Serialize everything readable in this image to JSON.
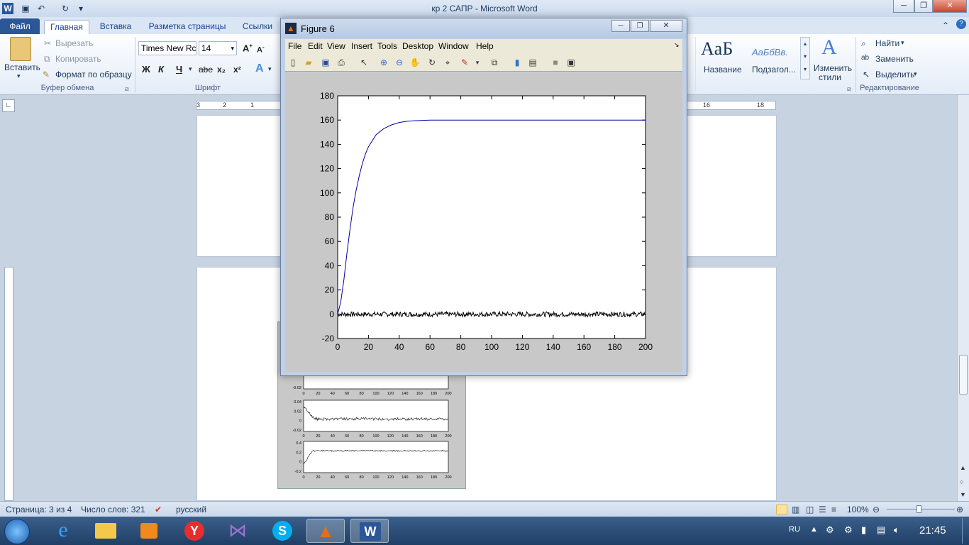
{
  "word": {
    "title": "кр 2 САПР  -  Microsoft Word",
    "tabs": [
      "Файл",
      "Главная",
      "Вставка",
      "Разметка страницы",
      "Ссылки"
    ],
    "clipboard": {
      "paste": "Вставить",
      "cut": "Вырезать",
      "copy": "Копировать",
      "format": "Формат по образцу",
      "label": "Буфер обмена"
    },
    "font": {
      "name": "Times New Rc",
      "size": "14",
      "label": "Шрифт",
      "bold": "Ж",
      "italic": "К",
      "underline": "Ч",
      "strike": "abe",
      "sub": "x₂",
      "sup": "x²"
    },
    "styles": {
      "s1_preview": "AaБ",
      "s1": "Название",
      "s2_preview": "AaБбВв.",
      "s2": "Подзагол...",
      "change": "Изменить",
      "change2": "стили"
    },
    "editing": {
      "find": "Найти",
      "replace": "Заменить",
      "select": "Выделить",
      "label": "Редактирование"
    },
    "ruler_right": [
      "16",
      "18"
    ],
    "ruler_left": [
      "3",
      "2",
      "1"
    ],
    "status": {
      "page": "Страница: 3 из 4",
      "words": "Число слов: 321",
      "lang": "русский",
      "zoom": "100%"
    }
  },
  "taskbar": {
    "lang": "RU",
    "time": "21:45"
  },
  "figure": {
    "title": "Figure 6",
    "menu": [
      "File",
      "Edit",
      "View",
      "Insert",
      "Tools",
      "Desktop",
      "Window",
      "Help"
    ]
  },
  "chart_data": {
    "type": "line",
    "xlim": [
      0,
      200
    ],
    "ylim": [
      -20,
      180
    ],
    "xticks": [
      0,
      20,
      40,
      60,
      80,
      100,
      120,
      140,
      160,
      180,
      200
    ],
    "yticks": [
      -20,
      0,
      20,
      40,
      60,
      80,
      100,
      120,
      140,
      160,
      180
    ],
    "series": [
      {
        "color": "#0000aa",
        "x": [
          0,
          2,
          4,
          6,
          8,
          10,
          12,
          14,
          16,
          18,
          20,
          25,
          30,
          35,
          40,
          45,
          50,
          60,
          70,
          80,
          100,
          120,
          140,
          160,
          180,
          200
        ],
        "values": [
          0,
          10,
          28,
          50,
          70,
          88,
          102,
          114,
          124,
          132,
          138,
          148,
          153,
          156,
          158,
          159,
          159.5,
          160,
          160,
          160,
          160,
          160,
          160,
          160,
          160,
          160
        ]
      },
      {
        "color": "#000000",
        "x": [
          0,
          200
        ],
        "values": [
          0,
          0
        ],
        "noise": 2
      }
    ]
  },
  "bg_chart_data": [
    {
      "type": "line",
      "xticks": [
        0,
        20,
        40,
        60,
        80,
        100,
        120,
        140,
        160,
        180,
        200
      ],
      "yticks": [
        "-0.02"
      ]
    },
    {
      "type": "line",
      "xticks": [
        0,
        20,
        40,
        60,
        80,
        100,
        120,
        140,
        160,
        180,
        200
      ],
      "yticks": [
        "0.04",
        "0.02",
        "0",
        "-0.02"
      ]
    },
    {
      "type": "line",
      "xticks": [
        0,
        20,
        40,
        60,
        80,
        100,
        120,
        140,
        160,
        180,
        200
      ],
      "yticks": [
        "0.4",
        "0.2",
        "0",
        "-0.2"
      ]
    }
  ]
}
